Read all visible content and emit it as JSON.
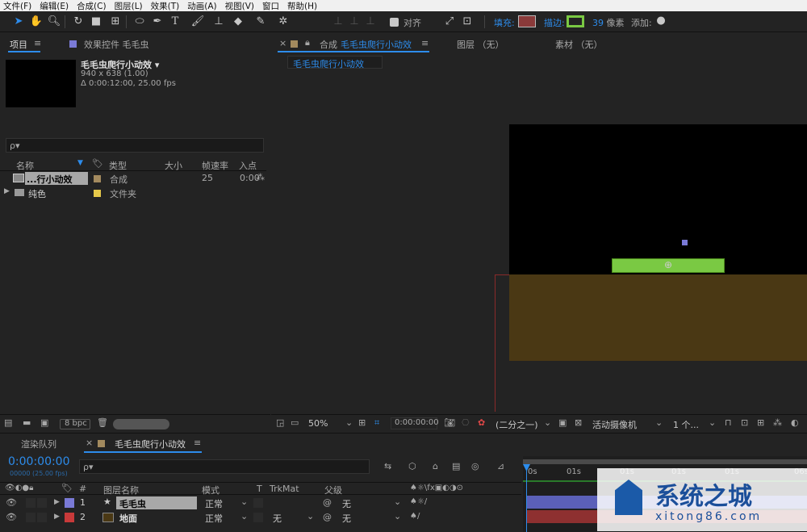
{
  "menu": [
    "文件(F)",
    "编辑(E)",
    "合成(C)",
    "图层(L)",
    "效果(T)",
    "动画(A)",
    "视图(V)",
    "窗口",
    "帮助(H)"
  ],
  "toolbar": {
    "align_label": "对齐",
    "fill_label": "填充:",
    "stroke_label": "描边:",
    "stroke_px": "39 像素",
    "add_label": "添加:",
    "fill_color": "#8a3a3a",
    "stroke_color": "#7ac943"
  },
  "project": {
    "tab_label": "项目",
    "effects_tab": "效果控件 毛毛虫",
    "comp_name": "毛毛虫爬行小动效 ▾",
    "comp_dims": "940 x 638 (1.00)",
    "comp_duration": "Δ 0:00:12:00, 25.00 fps",
    "search_placeholder": "ρ▾",
    "columns": [
      "名称",
      "类型",
      "大小",
      "帧速率",
      "入点"
    ],
    "items": [
      {
        "name": "...行小动效",
        "type": "合成",
        "size": "",
        "fps": "25",
        "inpoint": "0:00",
        "color": "#a38a5e"
      },
      {
        "name": "纯色",
        "type": "文件夹",
        "size": "",
        "fps": "",
        "inpoint": "",
        "color": "#e5c84a"
      }
    ],
    "bpc": "8 bpc"
  },
  "viewer": {
    "tab_prefix": "合成",
    "comp_tab": "毛毛虫爬行小动效",
    "layer_tab": "图层 （无）",
    "footage_tab": "素材 （无）",
    "breadcrumb": "毛毛虫爬行小动效",
    "zoom": "50%",
    "timecode": "0:00:00:00",
    "resolution": "(二分之一)",
    "camera": "活动摄像机",
    "views": "1 个..."
  },
  "timeline": {
    "render_tab": "渲染队列",
    "comp_tab": "毛毛虫爬行小动效",
    "timecode": "0:00:00:00",
    "fps_info": "00000 (25.00 fps)",
    "search_placeholder": "ρ▾",
    "columns": {
      "num": "#",
      "name": "图层名称",
      "mode": "模式",
      "t": "T",
      "trkmat": "TrkMat",
      "parent": "父级"
    },
    "layers": [
      {
        "num": "1",
        "name": "毛毛虫",
        "mode": "正常",
        "trkmat": "",
        "parent": "无",
        "color": "#7a7ad6",
        "bar_color": "#5b60b8"
      },
      {
        "num": "2",
        "name": "地面",
        "mode": "正常",
        "trkmat": "无",
        "parent": "无",
        "color": "#c83a3a",
        "bar_color": "#8e3030"
      }
    ],
    "ruler": [
      "0s",
      "01s",
      "01s",
      "01s",
      "01s",
      "06s"
    ]
  },
  "watermark": {
    "title": "系统之城",
    "url": "xitong86.com"
  }
}
